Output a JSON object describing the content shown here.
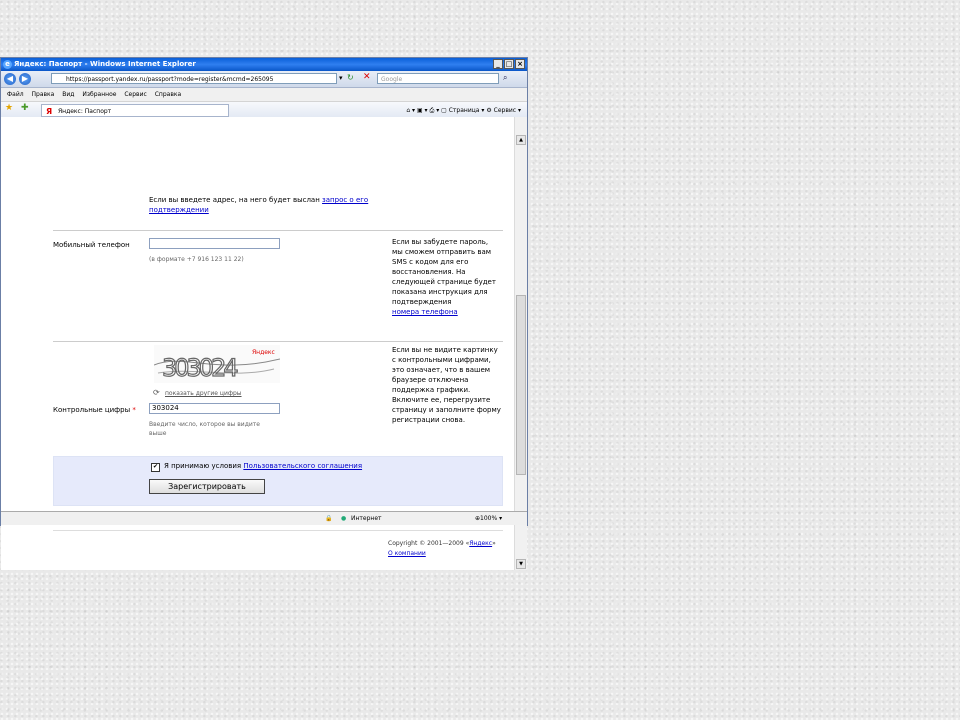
{
  "window": {
    "title": "Яндекс: Паспорт - Windows Internet Explorer",
    "controls": [
      "_",
      "□",
      "×"
    ]
  },
  "addressbar": {
    "url": "https://passport.yandex.ru/passport?mode=register&mcmd=265095",
    "search_placeholder": "Google"
  },
  "menubar": [
    "Файл",
    "Правка",
    "Вид",
    "Избранное",
    "Сервис",
    "Справка"
  ],
  "tab": {
    "title": "Яндекс: Паспорт"
  },
  "toolbar": {
    "page": "Страница",
    "tools": "Сервис"
  },
  "page": {
    "top_hint_line1": "Если вы введете адрес, на него будет выслан",
    "top_hint_link": "запрос о его",
    "top_hint_line2": "подтверждении",
    "mobile": {
      "label": "Мобильный телефон",
      "value": "",
      "format_hint": "(в формате +7 916 123 11 22)",
      "help_lines": [
        "Если вы забудете пароль,",
        "мы сможем отправить вам",
        "SMS с кодом для его",
        "восстановления. На",
        "следующей странице будет",
        "показана инструкция для",
        "подтверждения"
      ],
      "help_link": "номера телефона"
    },
    "captcha": {
      "image_text": "303024",
      "brand": "Яндекс",
      "show_other": "показать другие цифры",
      "label": "Контрольные цифры",
      "required_mark": "*",
      "value": "303024",
      "hint_line1": "Введите число, которое вы видите",
      "hint_line2": "выше",
      "help_lines": [
        "Если вы не видите картинку",
        "с контрольными цифрами,",
        "это означает, что в вашем",
        "браузере отключена",
        "поддержка графики.",
        "Включите ее, перегрузите",
        "страницу и заполните форму",
        "регистрации снова."
      ]
    },
    "agree": {
      "checked_mark": "✔",
      "text": "Я принимаю условия",
      "link": "Пользовательского соглашения",
      "submit": "Зарегистрировать"
    },
    "footer": {
      "copyright": "Copyright © 2001—2009 «",
      "copyright_link": "Яндекс",
      "copyright_end": "»",
      "about": "О компании"
    }
  },
  "statusbar": {
    "zone": "Интернет",
    "zoom": "100%"
  }
}
